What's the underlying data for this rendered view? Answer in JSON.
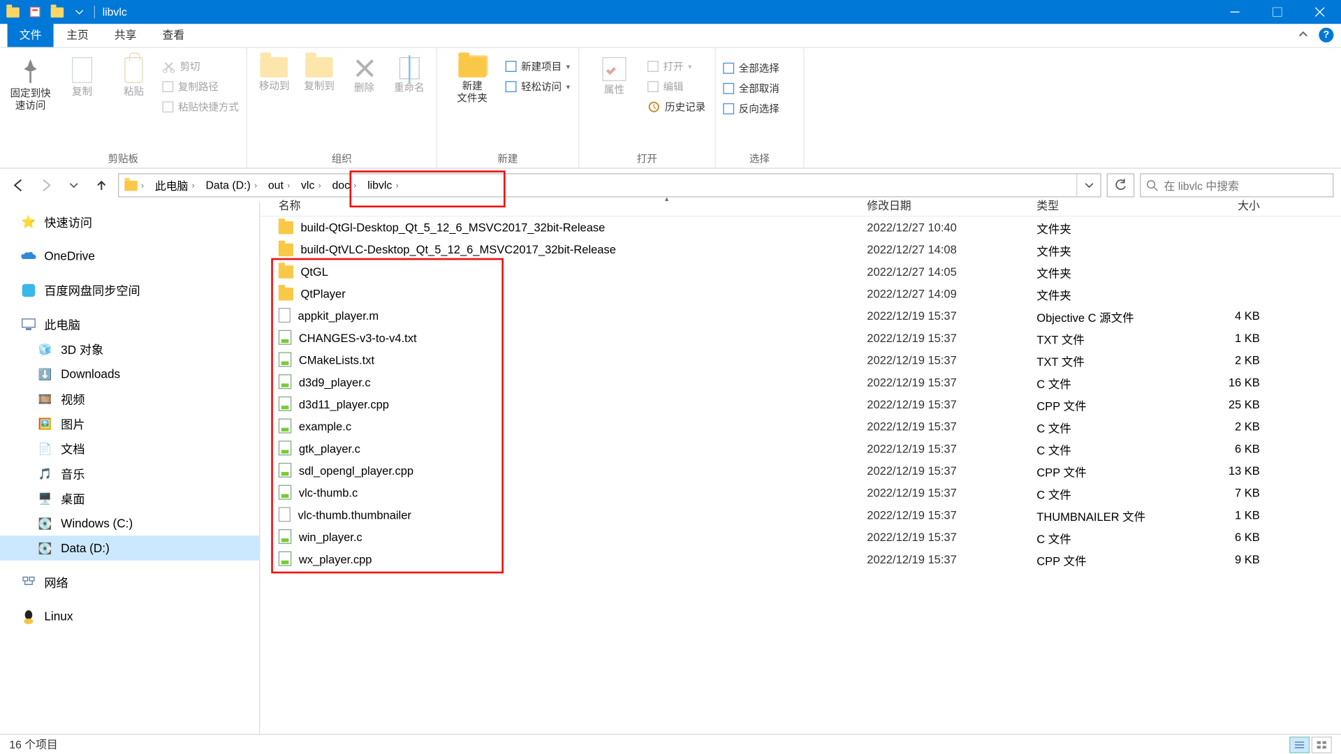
{
  "window": {
    "title": "libvlc"
  },
  "ribbon_tabs": {
    "file": "文件",
    "tabs": [
      "主页",
      "共享",
      "查看"
    ]
  },
  "ribbon": {
    "clipboard": {
      "pin": "固定到快\n速访问",
      "copy": "复制",
      "paste": "粘贴",
      "cut": "剪切",
      "copypath": "复制路径",
      "pasteshortcut": "粘贴快捷方式",
      "label": "剪贴板"
    },
    "organize": {
      "moveto": "移动到",
      "copyto": "复制到",
      "delete": "删除",
      "rename": "重命名",
      "label": "组织"
    },
    "new": {
      "newfolder": "新建\n文件夹",
      "newitem": "新建项目",
      "easyaccess": "轻松访问",
      "label": "新建"
    },
    "open": {
      "properties": "属性",
      "open": "打开",
      "edit": "编辑",
      "history": "历史记录",
      "label": "打开"
    },
    "select": {
      "all": "全部选择",
      "none": "全部取消",
      "invert": "反向选择",
      "label": "选择"
    }
  },
  "breadcrumbs": [
    "此电脑",
    "Data (D:)",
    "out",
    "vlc",
    "doc",
    "libvlc"
  ],
  "search": {
    "placeholder": "在 libvlc 中搜索"
  },
  "nav": {
    "quick": "快速访问",
    "onedrive": "OneDrive",
    "baidu": "百度网盘同步空间",
    "thispc": "此电脑",
    "pc_children": [
      "3D 对象",
      "Downloads",
      "视频",
      "图片",
      "文档",
      "音乐",
      "桌面",
      "Windows (C:)",
      "Data (D:)"
    ],
    "network": "网络",
    "linux": "Linux"
  },
  "columns": {
    "name": "名称",
    "date": "修改日期",
    "type": "类型",
    "size": "大小"
  },
  "files": [
    {
      "ic": "folder",
      "name": "build-QtGl-Desktop_Qt_5_12_6_MSVC2017_32bit-Release",
      "date": "2022/12/27 10:40",
      "type": "文件夹",
      "size": ""
    },
    {
      "ic": "folder",
      "name": "build-QtVLC-Desktop_Qt_5_12_6_MSVC2017_32bit-Release",
      "date": "2022/12/27 14:08",
      "type": "文件夹",
      "size": ""
    },
    {
      "ic": "folder",
      "name": "QtGL",
      "date": "2022/12/27 14:05",
      "type": "文件夹",
      "size": ""
    },
    {
      "ic": "folder",
      "name": "QtPlayer",
      "date": "2022/12/27 14:09",
      "type": "文件夹",
      "size": ""
    },
    {
      "ic": "file",
      "name": "appkit_player.m",
      "date": "2022/12/19 15:37",
      "type": "Objective C 源文件",
      "size": "4 KB"
    },
    {
      "ic": "src",
      "name": "CHANGES-v3-to-v4.txt",
      "date": "2022/12/19 15:37",
      "type": "TXT 文件",
      "size": "1 KB"
    },
    {
      "ic": "src",
      "name": "CMakeLists.txt",
      "date": "2022/12/19 15:37",
      "type": "TXT 文件",
      "size": "2 KB"
    },
    {
      "ic": "src",
      "name": "d3d9_player.c",
      "date": "2022/12/19 15:37",
      "type": "C 文件",
      "size": "16 KB"
    },
    {
      "ic": "src",
      "name": "d3d11_player.cpp",
      "date": "2022/12/19 15:37",
      "type": "CPP 文件",
      "size": "25 KB"
    },
    {
      "ic": "src",
      "name": "example.c",
      "date": "2022/12/19 15:37",
      "type": "C 文件",
      "size": "2 KB"
    },
    {
      "ic": "src",
      "name": "gtk_player.c",
      "date": "2022/12/19 15:37",
      "type": "C 文件",
      "size": "6 KB"
    },
    {
      "ic": "src",
      "name": "sdl_opengl_player.cpp",
      "date": "2022/12/19 15:37",
      "type": "CPP 文件",
      "size": "13 KB"
    },
    {
      "ic": "src",
      "name": "vlc-thumb.c",
      "date": "2022/12/19 15:37",
      "type": "C 文件",
      "size": "7 KB"
    },
    {
      "ic": "file",
      "name": "vlc-thumb.thumbnailer",
      "date": "2022/12/19 15:37",
      "type": "THUMBNAILER 文件",
      "size": "1 KB"
    },
    {
      "ic": "src",
      "name": "win_player.c",
      "date": "2022/12/19 15:37",
      "type": "C 文件",
      "size": "6 KB"
    },
    {
      "ic": "src",
      "name": "wx_player.cpp",
      "date": "2022/12/19 15:37",
      "type": "CPP 文件",
      "size": "9 KB"
    }
  ],
  "status": {
    "count_label": "16 个项目"
  },
  "highlight": {
    "path_start_idx": 3,
    "files_start_idx": 2,
    "files_end_idx": 15
  }
}
